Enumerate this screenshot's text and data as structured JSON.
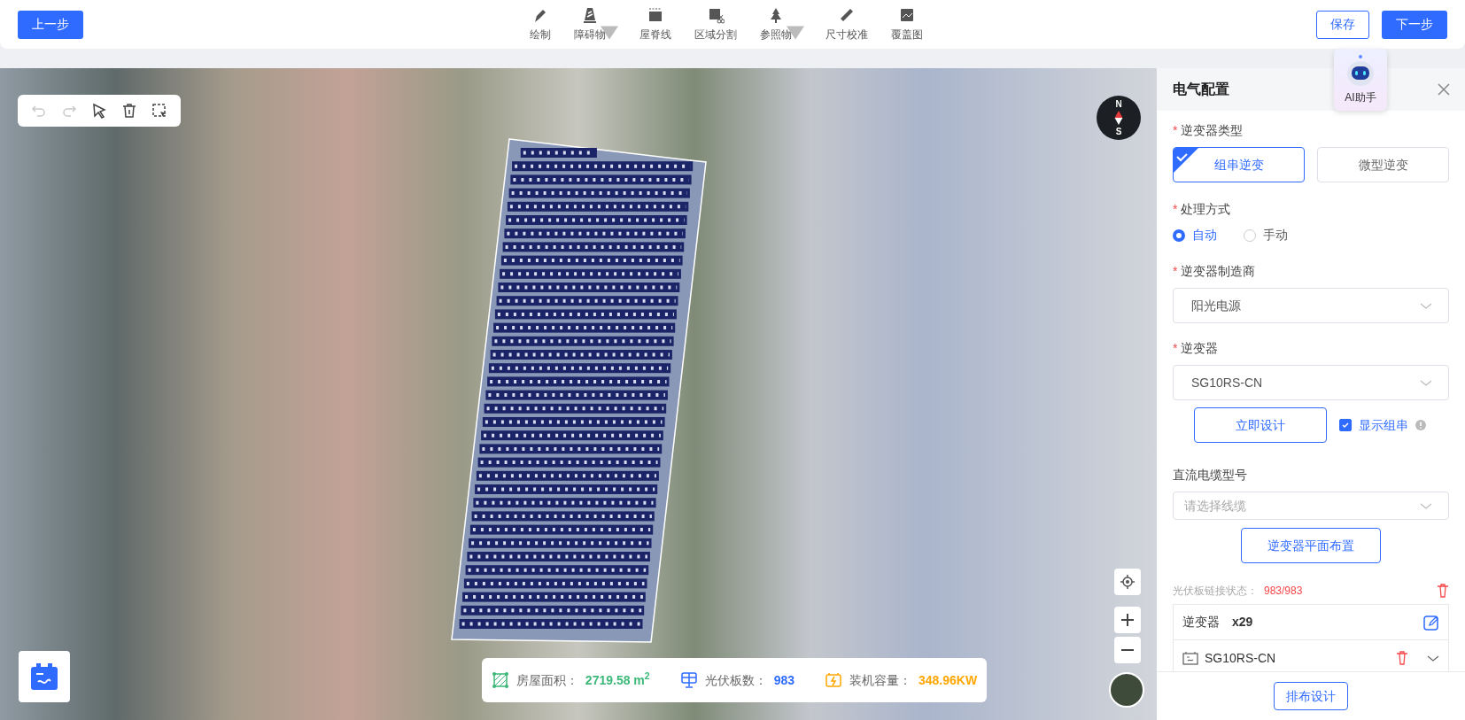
{
  "top_bar": {
    "back_button": "上一步",
    "tools": [
      {
        "label": "绘制",
        "kind": "pen",
        "dropdown": false
      },
      {
        "label": "障碍物",
        "kind": "cone",
        "dropdown": true
      },
      {
        "label": "屋脊线",
        "kind": "ridge",
        "dropdown": false
      },
      {
        "label": "区域分割",
        "kind": "cut",
        "dropdown": false
      },
      {
        "label": "参照物",
        "kind": "tree",
        "dropdown": true
      },
      {
        "label": "尺寸校准",
        "kind": "ruler",
        "dropdown": false
      },
      {
        "label": "覆盖图",
        "kind": "overlay",
        "dropdown": false
      }
    ],
    "save_button": "保存",
    "next_button": "下一步"
  },
  "map": {
    "edit_tools": [
      {
        "kind": "undo",
        "disabled": true
      },
      {
        "kind": "redo",
        "disabled": true
      },
      {
        "kind": "pointer",
        "disabled": false
      },
      {
        "kind": "trash",
        "disabled": false
      },
      {
        "kind": "select",
        "disabled": false
      }
    ],
    "compass": {
      "north": "N",
      "south": "S"
    },
    "stats": [
      {
        "kind": "area",
        "label": "房屋面积：",
        "value": "2719.58 m$^{2}$",
        "color": "#3cb878"
      },
      {
        "kind": "panel",
        "label": "光伏板数：",
        "value": "983",
        "color": "#2f6bff"
      },
      {
        "kind": "power",
        "label": "装机容量：",
        "value": "348.96KW",
        "color": "#ffa600"
      }
    ]
  },
  "ai_assistant": {
    "label": "AI助手"
  },
  "panel": {
    "title": "电气配置",
    "inverter_type": {
      "mark": "*",
      "label": "逆变器类型",
      "options": [
        {
          "label": "组串逆变",
          "selected": true
        },
        {
          "label": "微型逆变",
          "selected": false
        }
      ]
    },
    "process": {
      "mark": "*",
      "label": "处理方式",
      "options": [
        {
          "label": "自动",
          "selected": true
        },
        {
          "label": "手动",
          "selected": false
        }
      ]
    },
    "manufacturer": {
      "mark": "*",
      "label": "逆变器制造商",
      "value": "阳光电源"
    },
    "inverter": {
      "mark": "*",
      "label": "逆变器",
      "value": "SG10RS-CN"
    },
    "design_button": "立即设计",
    "show_strings": {
      "label": "显示组串",
      "checked": true
    },
    "cable": {
      "label": "直流电缆型号",
      "placeholder": "请选择线缆"
    },
    "layout_button": "逆变器平面布置",
    "link_status": {
      "label": "光伏板链接状态：",
      "value": "983/983"
    },
    "inverter_list": {
      "label": "逆变器",
      "count": "x29",
      "items": [
        {
          "name": "SG10RS-CN"
        }
      ]
    },
    "footer_button": "排布设计"
  }
}
